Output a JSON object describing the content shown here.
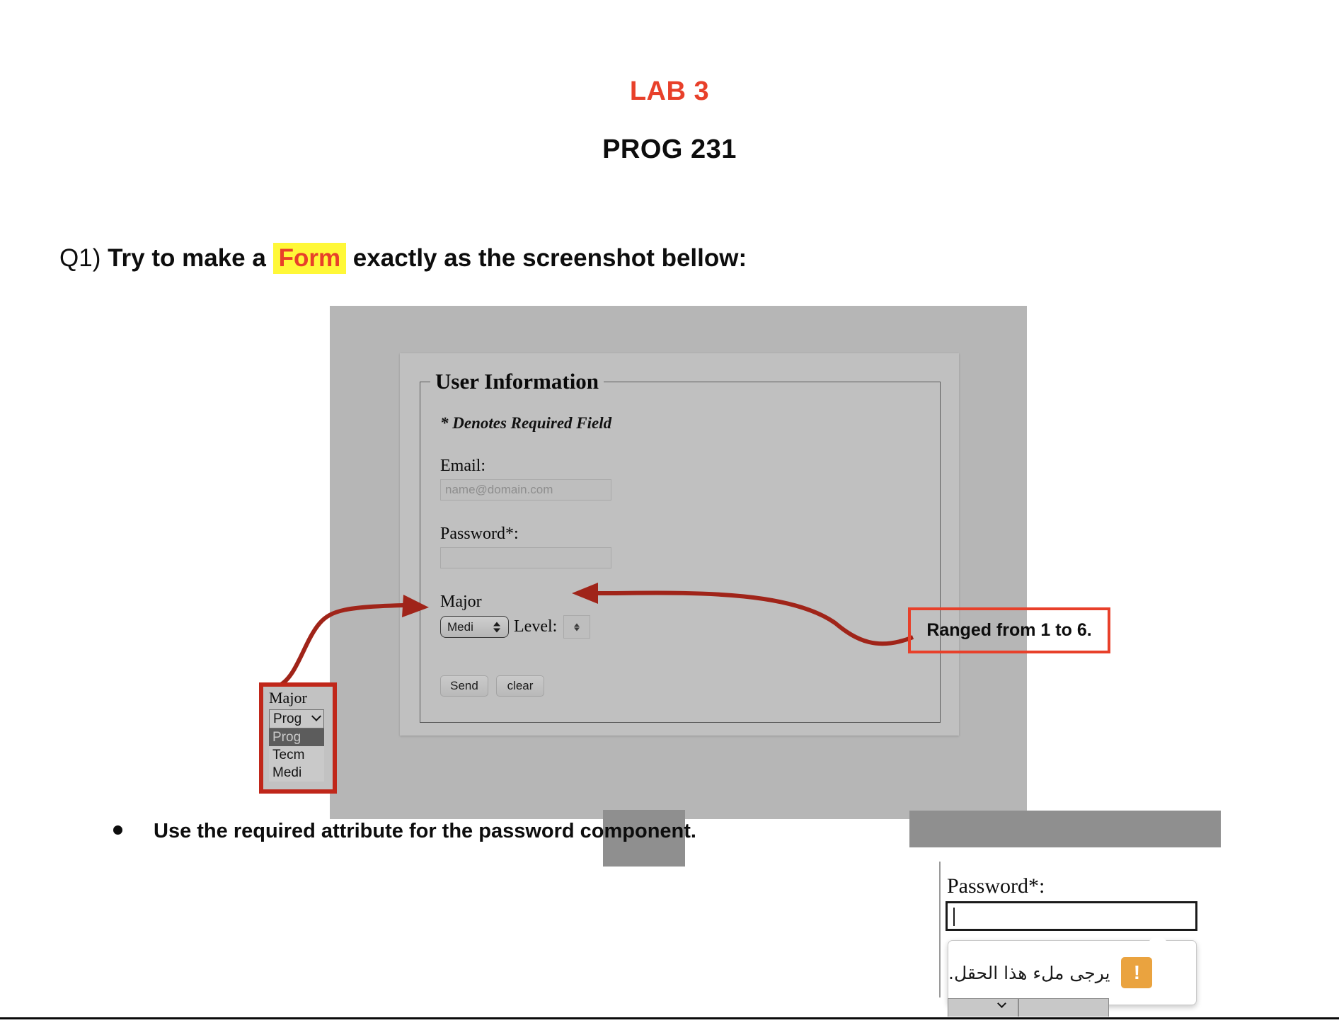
{
  "header": {
    "lab_title": "LAB 3",
    "course_title": "PROG 231",
    "accent_color": "#E8402A",
    "highlight_color": "#FFF838"
  },
  "question": {
    "number": "Q1)",
    "part_before": "Try to make a",
    "highlighted_word": "Form",
    "part_after": "exactly as the screenshot bellow:"
  },
  "form_screenshot": {
    "legend": "User Information",
    "required_note": "* Denotes Required Field",
    "email": {
      "label": "Email:",
      "placeholder": "name@domain.com",
      "value": ""
    },
    "password": {
      "label": "Password*:",
      "placeholder": "",
      "value": ""
    },
    "major": {
      "label": "Major",
      "selected": "Medi",
      "options": [
        "Prog",
        "Tecm",
        "Medi"
      ]
    },
    "level": {
      "label": "Level:",
      "value": "",
      "min": "1",
      "max": "6"
    },
    "buttons": {
      "submit": "Send",
      "reset": "clear"
    }
  },
  "annotations": {
    "ranged_note": "Ranged from 1 to 6.",
    "border_color": "#E8402A"
  },
  "dropdown_callout": {
    "label": "Major",
    "selected": "Prog",
    "options": [
      {
        "label": "Prog",
        "selected": true
      },
      {
        "label": "Tecm",
        "selected": false
      },
      {
        "label": "Medi",
        "selected": false
      }
    ],
    "border_color": "#C0271A"
  },
  "bullet": {
    "text": "Use the required attribute for the password component."
  },
  "validation_snippet": {
    "password_label": "Password*:",
    "password_value": "",
    "tooltip_message": "يرجى ملء هذا الحقل.",
    "tooltip_icon": "!",
    "tooltip_icon_color": "#EAA33F"
  }
}
